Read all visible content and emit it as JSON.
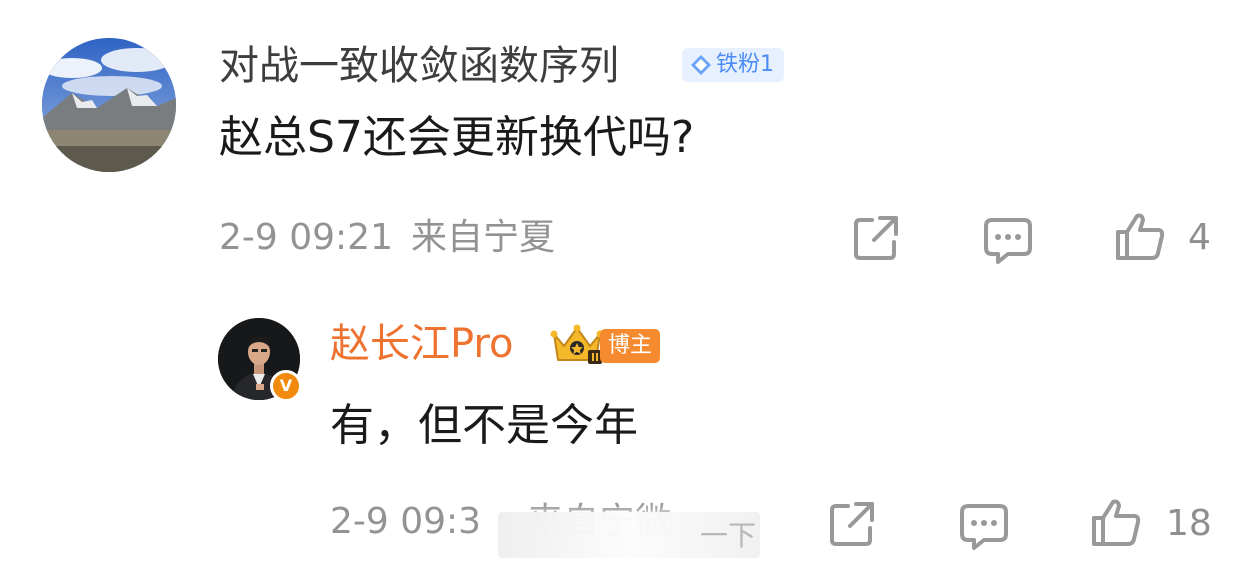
{
  "comment": {
    "username": "对战一致收敛函数序列",
    "fan_badge": "铁粉1",
    "text": "赵总S7还会更新换代吗?",
    "time": "2-9 09:21",
    "location": "来自宁夏",
    "like_count": "4",
    "colors": {
      "username": "#3d3d3d",
      "fan_badge_bg": "#e6f0ff",
      "fan_badge_text": "#4d8cf5"
    }
  },
  "reply": {
    "username": "赵长江Pro",
    "role_badge": "博主",
    "verified_mark": "V",
    "text": "有，但不是今年",
    "time": "2-9 09:3",
    "location": "来自宁微",
    "like_count": "18",
    "colors": {
      "username": "#ee7330",
      "role_badge_bg": "#f68a2e"
    }
  },
  "toast": {
    "text": "一下"
  },
  "icons": {
    "share": "share-icon",
    "comment": "comment-icon",
    "like": "thumbs-up-icon",
    "crown": "crown-icon",
    "diamond": "diamond-icon"
  }
}
